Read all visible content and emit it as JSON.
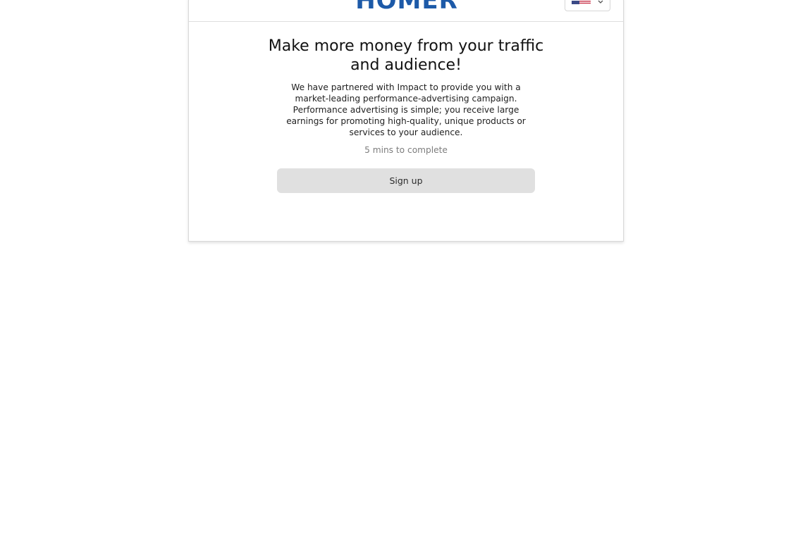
{
  "header": {
    "logo_text": "HOMER",
    "language_selector": {
      "flag_icon": "us-flag-icon",
      "chevron_icon": "chevron-down-icon"
    }
  },
  "main": {
    "title": "Make more money from your traffic and audience!",
    "description": "We have partnered with Impact to provide you with a market-leading performance-advertising campaign. Performance advertising is simple; you receive large earnings for promoting high-quality, unique products or services to your audience.",
    "time_to_complete": "5 mins to complete",
    "signup_label": "Sign up"
  },
  "colors": {
    "brand": "#1d5aa8",
    "button_bg": "#e0e0e0",
    "muted_text": "#7d7d7d",
    "card_border": "#d9d9d9"
  }
}
